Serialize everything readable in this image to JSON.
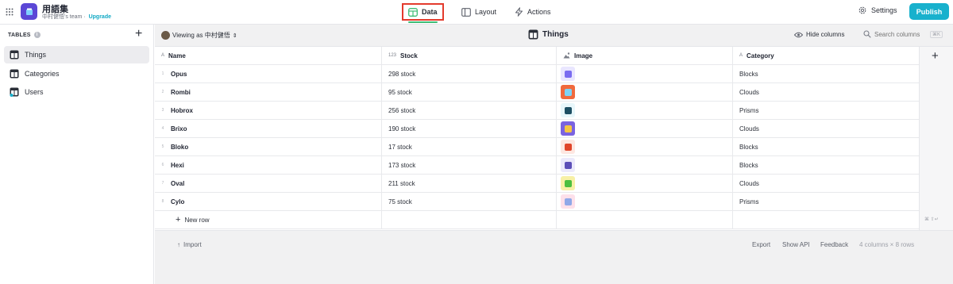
{
  "app": {
    "title": "用語集",
    "team": "中村健悟's team",
    "separator": "·",
    "upgrade": "Upgrade"
  },
  "nav": {
    "data": "Data",
    "layout": "Layout",
    "actions": "Actions"
  },
  "header": {
    "settings": "Settings",
    "publish": "Publish"
  },
  "sidebar": {
    "heading": "TABLES",
    "items": [
      {
        "label": "Things",
        "active": true
      },
      {
        "label": "Categories",
        "active": false
      },
      {
        "label": "Users",
        "active": false
      }
    ]
  },
  "toolbar": {
    "viewing_as": "Viewing as 中村健悟",
    "table_title": "Things",
    "hide_columns": "Hide columns",
    "search_placeholder": "Search columns",
    "search_shortcut": "⌘K"
  },
  "columns": [
    {
      "type_icon": "A",
      "label": "Name"
    },
    {
      "type_icon": "123",
      "label": "Stock"
    },
    {
      "type_icon": "img",
      "label": "Image"
    },
    {
      "type_icon": "A",
      "label": "Category"
    }
  ],
  "rows": [
    {
      "num": "1",
      "name": "Opus",
      "stock": "298 stock",
      "thumb_bg": "#e9e6ff",
      "thumb_fg": "#7a6cf0",
      "category": "Blocks"
    },
    {
      "num": "2",
      "name": "Rombi",
      "stock": "95 stock",
      "thumb_bg": "#f06a3d",
      "thumb_fg": "#7dd3f5",
      "category": "Clouds"
    },
    {
      "num": "3",
      "name": "Hobrox",
      "stock": "256 stock",
      "thumb_bg": "#e8f7fb",
      "thumb_fg": "#1d4f63",
      "category": "Prisms"
    },
    {
      "num": "4",
      "name": "Brixo",
      "stock": "190 stock",
      "thumb_bg": "#7a63e0",
      "thumb_fg": "#f5c542",
      "category": "Clouds"
    },
    {
      "num": "5",
      "name": "Bloko",
      "stock": "17 stock",
      "thumb_bg": "#fde7e1",
      "thumb_fg": "#e0452a",
      "category": "Blocks"
    },
    {
      "num": "6",
      "name": "Hexi",
      "stock": "173 stock",
      "thumb_bg": "#ebe9fb",
      "thumb_fg": "#5c4fb8",
      "category": "Blocks"
    },
    {
      "num": "7",
      "name": "Oval",
      "stock": "211 stock",
      "thumb_bg": "#f7f0a6",
      "thumb_fg": "#4cbf3f",
      "category": "Clouds"
    },
    {
      "num": "8",
      "name": "Cylo",
      "stock": "75 stock",
      "thumb_bg": "#fde0ea",
      "thumb_fg": "#8fa8e8",
      "category": "Prisms"
    }
  ],
  "new_row": "New row",
  "enter_hint": "⌘ ⇧↵",
  "footer": {
    "import": "Import",
    "export": "Export",
    "show_api": "Show API",
    "feedback": "Feedback",
    "count": "4 columns × 8 rows"
  },
  "colors": {
    "accent": "#18b1cd",
    "highlight_box": "#e33b2d",
    "active_underline": "#3fbd76"
  }
}
